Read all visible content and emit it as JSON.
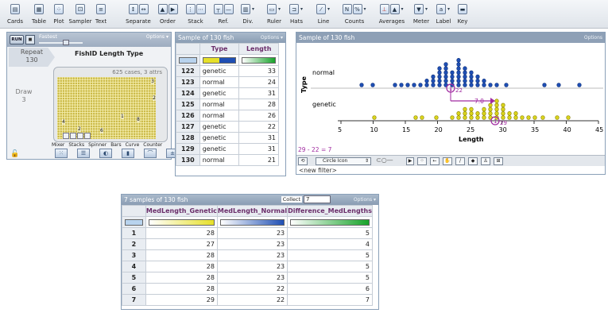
{
  "toolbar": {
    "items": [
      {
        "label": "Cards",
        "icon": "cards-icon"
      },
      {
        "label": "Table",
        "icon": "table-icon"
      },
      {
        "label": "Plot",
        "icon": "plot-icon"
      },
      {
        "label": "Sampler",
        "icon": "sampler-icon"
      },
      {
        "label": "Text",
        "icon": "text-icon"
      },
      {
        "label": "Separate",
        "icon": "separate-icon"
      },
      {
        "label": "Order",
        "icon": "order-icon"
      },
      {
        "label": "Stack",
        "icon": "stack-icon"
      },
      {
        "label": "Ref.",
        "icon": "reference-icon"
      },
      {
        "label": "Div.",
        "icon": "divider-icon"
      },
      {
        "label": "Ruler",
        "icon": "ruler-icon"
      },
      {
        "label": "Hats",
        "icon": "hats-icon"
      },
      {
        "label": "Line",
        "icon": "line-icon"
      },
      {
        "label": "Counts",
        "icon": "counts-icon"
      },
      {
        "label": "Averages",
        "icon": "averages-icon"
      },
      {
        "label": "Meter",
        "icon": "meter-icon"
      },
      {
        "label": "Label",
        "icon": "label-icon"
      },
      {
        "label": "Key",
        "icon": "key-icon"
      }
    ]
  },
  "sampler": {
    "run_label": "RUN",
    "speed_label": "Fastest",
    "options_label": "Options",
    "repeat_label": "Repeat",
    "repeat_value": "130",
    "title": "FishID Length Type",
    "draw_label": "Draw",
    "draw_value": "3",
    "cases_text": "625 cases, 3 attrs",
    "mixer_numbers": [
      "3",
      "2",
      "4",
      "1",
      "2",
      "8",
      "6"
    ],
    "devices": [
      "Mixer",
      "Stacks",
      "Spinner",
      "Bars",
      "Curve",
      "Counter"
    ]
  },
  "sample_table": {
    "title": "Sample of 130 fish",
    "options_label": "Options",
    "columns": [
      "Type",
      "Length"
    ],
    "rows": [
      {
        "id": "122",
        "type": "genetic",
        "length": "33"
      },
      {
        "id": "123",
        "type": "normal",
        "length": "24"
      },
      {
        "id": "124",
        "type": "genetic",
        "length": "31"
      },
      {
        "id": "125",
        "type": "normal",
        "length": "28"
      },
      {
        "id": "126",
        "type": "normal",
        "length": "26"
      },
      {
        "id": "127",
        "type": "genetic",
        "length": "22"
      },
      {
        "id": "128",
        "type": "genetic",
        "length": "31"
      },
      {
        "id": "129",
        "type": "genetic",
        "length": "31"
      },
      {
        "id": "130",
        "type": "normal",
        "length": "21"
      }
    ]
  },
  "graph": {
    "title": "Sample of 130 fish",
    "options_label": "Options",
    "y_label": "Type",
    "x_label": "Length",
    "categories": [
      "normal",
      "genetic"
    ],
    "ticks": [
      "5",
      "10",
      "15",
      "20",
      "25",
      "30",
      "35",
      "40",
      "45"
    ],
    "median_normal": "22",
    "median_genetic": "29",
    "difference_label": "7.0",
    "formula": "29 - 22 = 7",
    "icon_menu_label": "Circle Icon",
    "new_filter": "<new filter>",
    "colors": {
      "normal": "#1f4fb4",
      "genetic": "#d9d41c",
      "median": "#a02aa0"
    }
  },
  "collect_table": {
    "title": "7 samples of 130 fish",
    "collect_label": "Collect",
    "collect_value": "7",
    "options_label": "Options",
    "columns": [
      "MedLength_Genetic",
      "MedLength_Normal",
      "Difference_MedLengths"
    ],
    "rows": [
      {
        "id": "1",
        "genetic": "28",
        "normal": "23",
        "diff": "5"
      },
      {
        "id": "2",
        "genetic": "27",
        "normal": "23",
        "diff": "4"
      },
      {
        "id": "3",
        "genetic": "28",
        "normal": "23",
        "diff": "5"
      },
      {
        "id": "4",
        "genetic": "28",
        "normal": "23",
        "diff": "5"
      },
      {
        "id": "5",
        "genetic": "28",
        "normal": "23",
        "diff": "5"
      },
      {
        "id": "6",
        "genetic": "28",
        "normal": "22",
        "diff": "6"
      },
      {
        "id": "7",
        "genetic": "29",
        "normal": "22",
        "diff": "7"
      }
    ]
  }
}
